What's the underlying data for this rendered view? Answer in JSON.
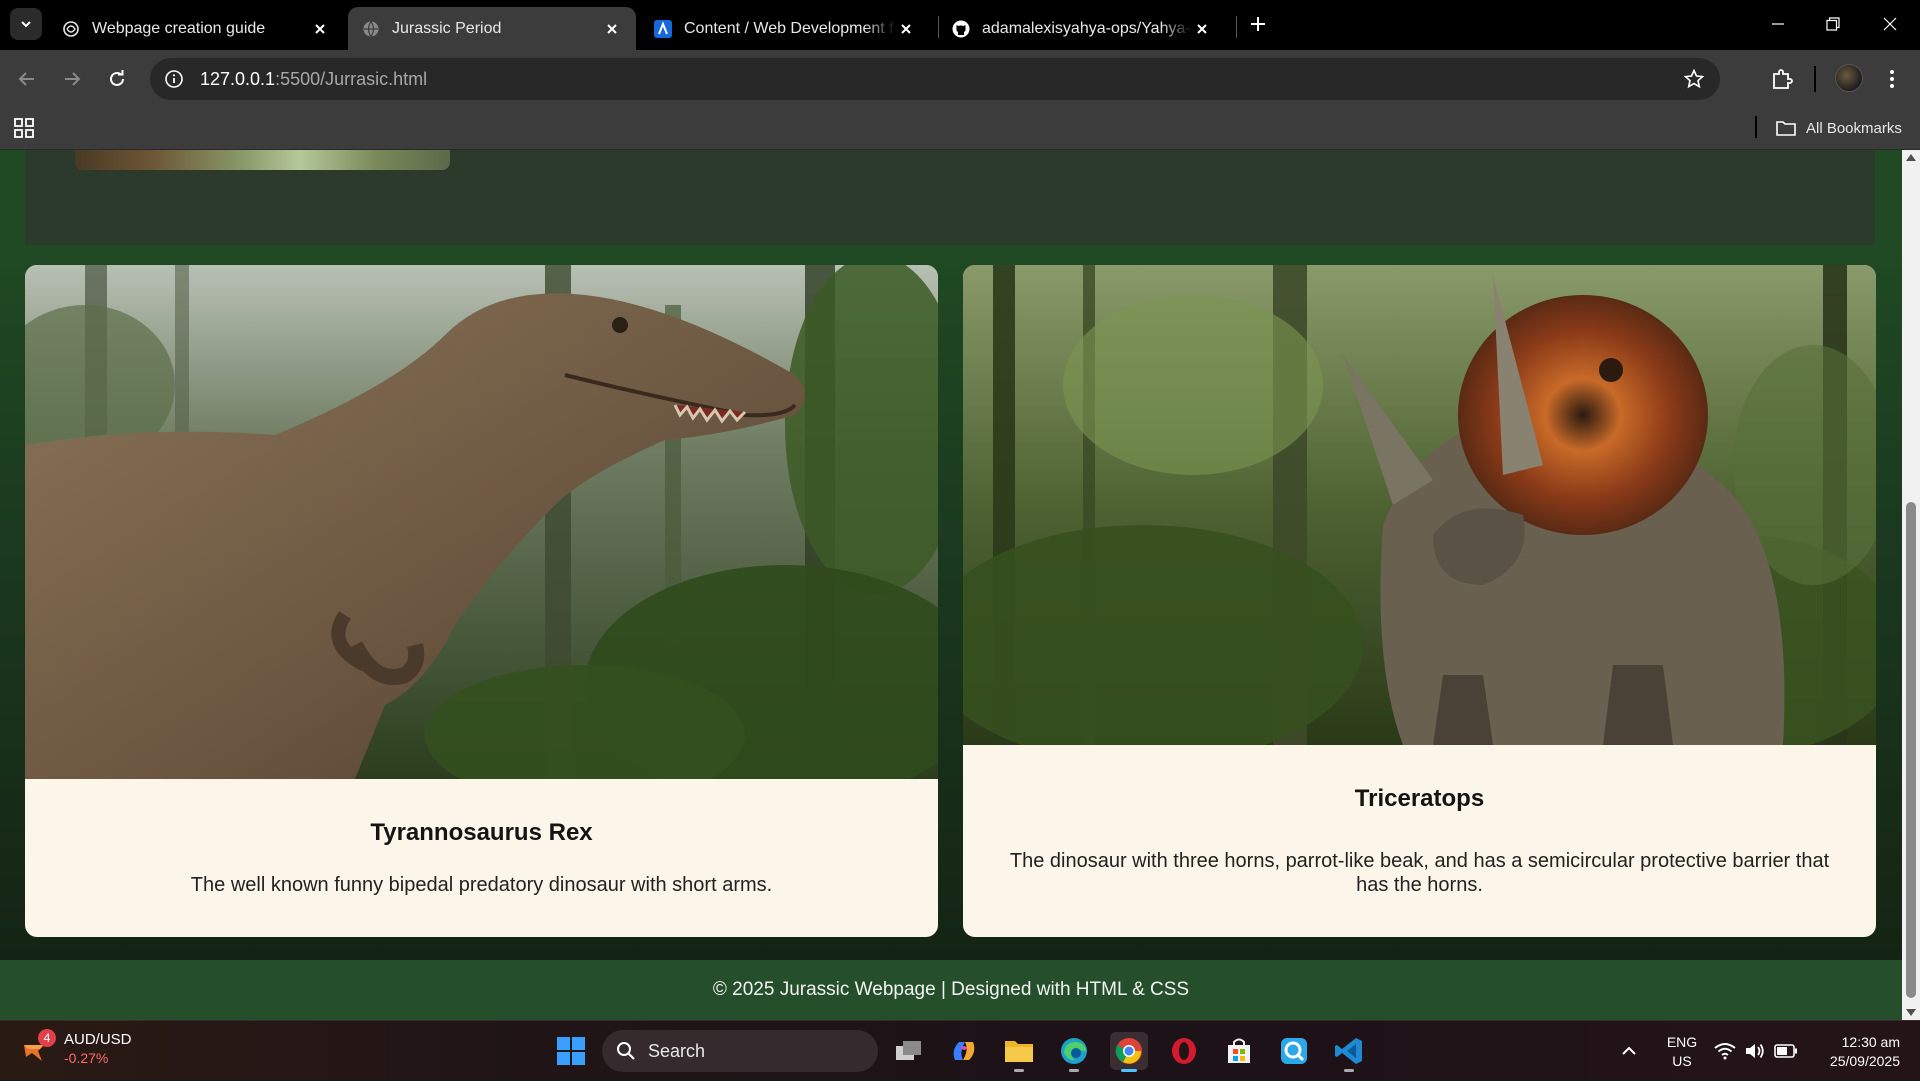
{
  "browser": {
    "tabs": [
      {
        "title": "Webpage creation guide",
        "icon": "openai-icon",
        "active": false
      },
      {
        "title": "Jurassic Period",
        "icon": "globe-icon",
        "active": true
      },
      {
        "title": "Content / Web Development fo",
        "icon": "atlassian-icon",
        "active": false
      },
      {
        "title": "adamalexisyahya-ops/Yahya---F",
        "icon": "github-icon",
        "active": false
      }
    ],
    "url_host": "127.0.0.1",
    "url_rest": ":5500/Jurrasic.html",
    "all_bookmarks_label": "All Bookmarks"
  },
  "page": {
    "cards": [
      {
        "title": "Tyrannosaurus Rex",
        "description": "The well known funny bipedal predatory dinosaur with short arms."
      },
      {
        "title": "Triceratops",
        "description": "The dinosaur with three horns, parrot-like beak, and has a semicircular protective barrier that has the horns."
      }
    ],
    "footer": "© 2025 Jurassic Webpage | Designed with HTML & CSS"
  },
  "taskbar": {
    "widget_title": "AUD/USD",
    "widget_change": "-0.27%",
    "widget_badge": "4",
    "search_label": "Search",
    "lang_top": "ENG",
    "lang_bottom": "US",
    "time": "12:30 am",
    "date": "25/09/2025"
  }
}
